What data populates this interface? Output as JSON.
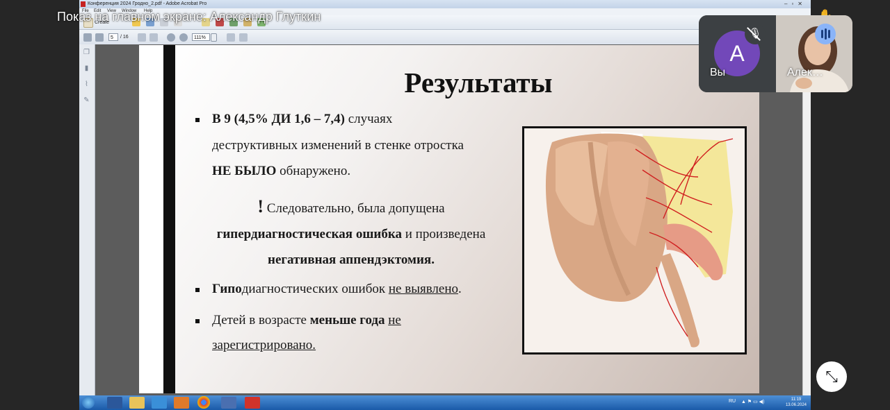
{
  "meet": {
    "presenting_label": "Показ на главном экране: Александр Глуткин",
    "self_tile": {
      "avatar_letter": "A",
      "name": "Вы"
    },
    "remote_tile": {
      "name": "Алек…"
    }
  },
  "acrobat": {
    "window_title": "Конференция 2024 Гродно_2.pdf - Adobe Acrobat Pro",
    "menu": [
      "File",
      "Edit",
      "View",
      "Window",
      "Help"
    ],
    "create_label": "Create",
    "page_current": "5",
    "page_total": "/ 16",
    "zoom": "111%"
  },
  "slide": {
    "title": "Результаты",
    "b1_bold": "В 9 (4,5% ДИ 1,6 – 7,4)",
    "b1_rest": " случаях",
    "b1_line2": "деструктивных изменений в стенке отростка",
    "b1_line3_bold": "НЕ БЫЛО",
    "b1_line3_rest": " обнаружено.",
    "p_exclaim": "!",
    "p_line1": " Следовательно, была допущена",
    "p_line2_bold": "гипердиагностическая ошибка",
    "p_line2_rest": " и произведена",
    "p_line3_bold": "негативная аппендэктомия.",
    "b2_bold": "Гипо",
    "b2_mid": "диагностических ошибок ",
    "b2_under": "не выявлено",
    "b2_end": ".",
    "b3_pre": "Детей в возрасте ",
    "b3_bold": "меньше года",
    "b3_space": " ",
    "b3_under1": "не",
    "b3_under2": "зарегистрировано."
  },
  "taskbar": {
    "lang": "RU",
    "time": "11:19",
    "date": "13.06.2024"
  }
}
